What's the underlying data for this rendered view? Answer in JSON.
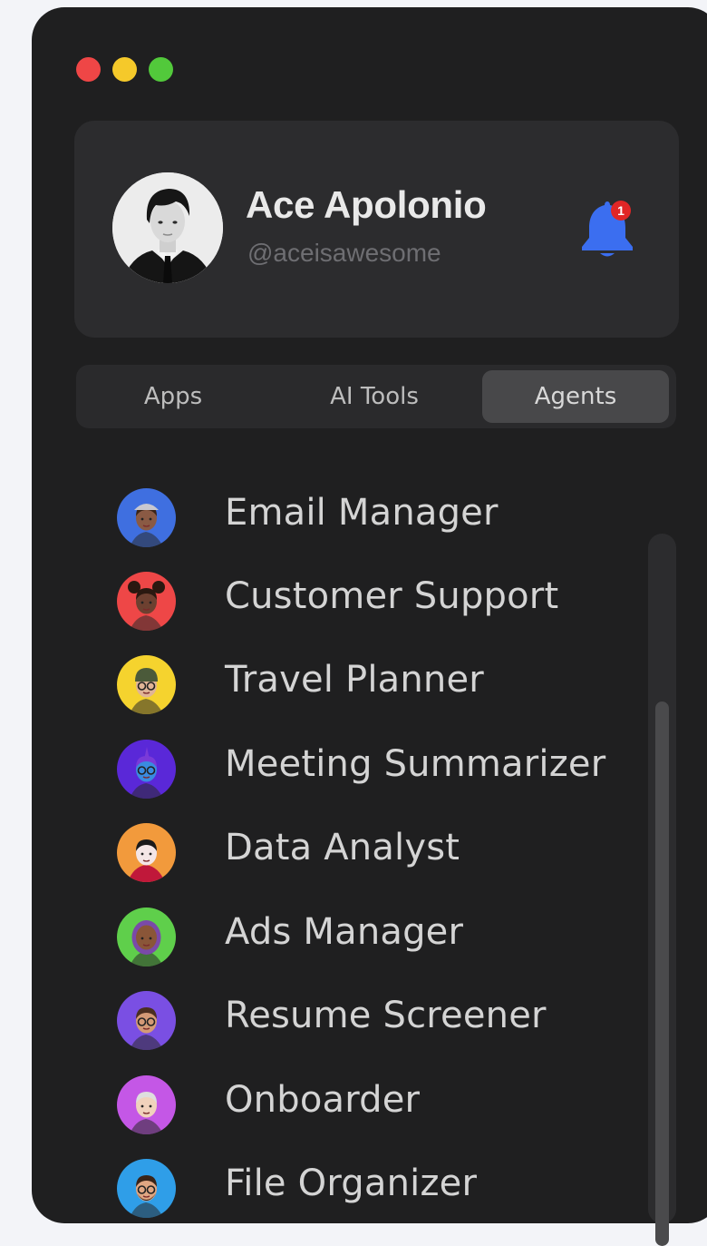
{
  "window": {
    "traffic_lights": [
      {
        "name": "close",
        "color": "#ef4646"
      },
      {
        "name": "minimize",
        "color": "#f5c92a"
      },
      {
        "name": "zoom",
        "color": "#52c93b"
      }
    ]
  },
  "profile": {
    "name": "Ace Apolonio",
    "handle": "@aceisawesome",
    "notification_count": "1",
    "bell_color": "#3b6ef0",
    "avatar_icon": "user-photo"
  },
  "tabs": [
    {
      "label": "Apps",
      "active": false
    },
    {
      "label": "AI Tools",
      "active": false
    },
    {
      "label": "Agents",
      "active": true
    }
  ],
  "agents": [
    {
      "label": "Email Manager",
      "avatar_color": "#3f6fe0",
      "avatar_icon": "memoji-woman-cap"
    },
    {
      "label": "Customer Support",
      "avatar_color": "#ee4747",
      "avatar_icon": "memoji-puffs"
    },
    {
      "label": "Travel Planner",
      "avatar_color": "#f5d32e",
      "avatar_icon": "memoji-beanie-glasses"
    },
    {
      "label": "Meeting Summarizer",
      "avatar_color": "#5a28d8",
      "avatar_icon": "memoji-blue-alien"
    },
    {
      "label": "Data Analyst",
      "avatar_color": "#f29a3c",
      "avatar_icon": "memoji-vampire"
    },
    {
      "label": "Ads Manager",
      "avatar_color": "#5fcf4b",
      "avatar_icon": "memoji-hijab"
    },
    {
      "label": "Resume Screener",
      "avatar_color": "#7a4fe3",
      "avatar_icon": "memoji-glasses-man"
    },
    {
      "label": "Onboarder",
      "avatar_color": "#c457e6",
      "avatar_icon": "memoji-grandma"
    },
    {
      "label": "File Organizer",
      "avatar_color": "#2f9ee8",
      "avatar_icon": "memoji-beard-glasses"
    }
  ]
}
